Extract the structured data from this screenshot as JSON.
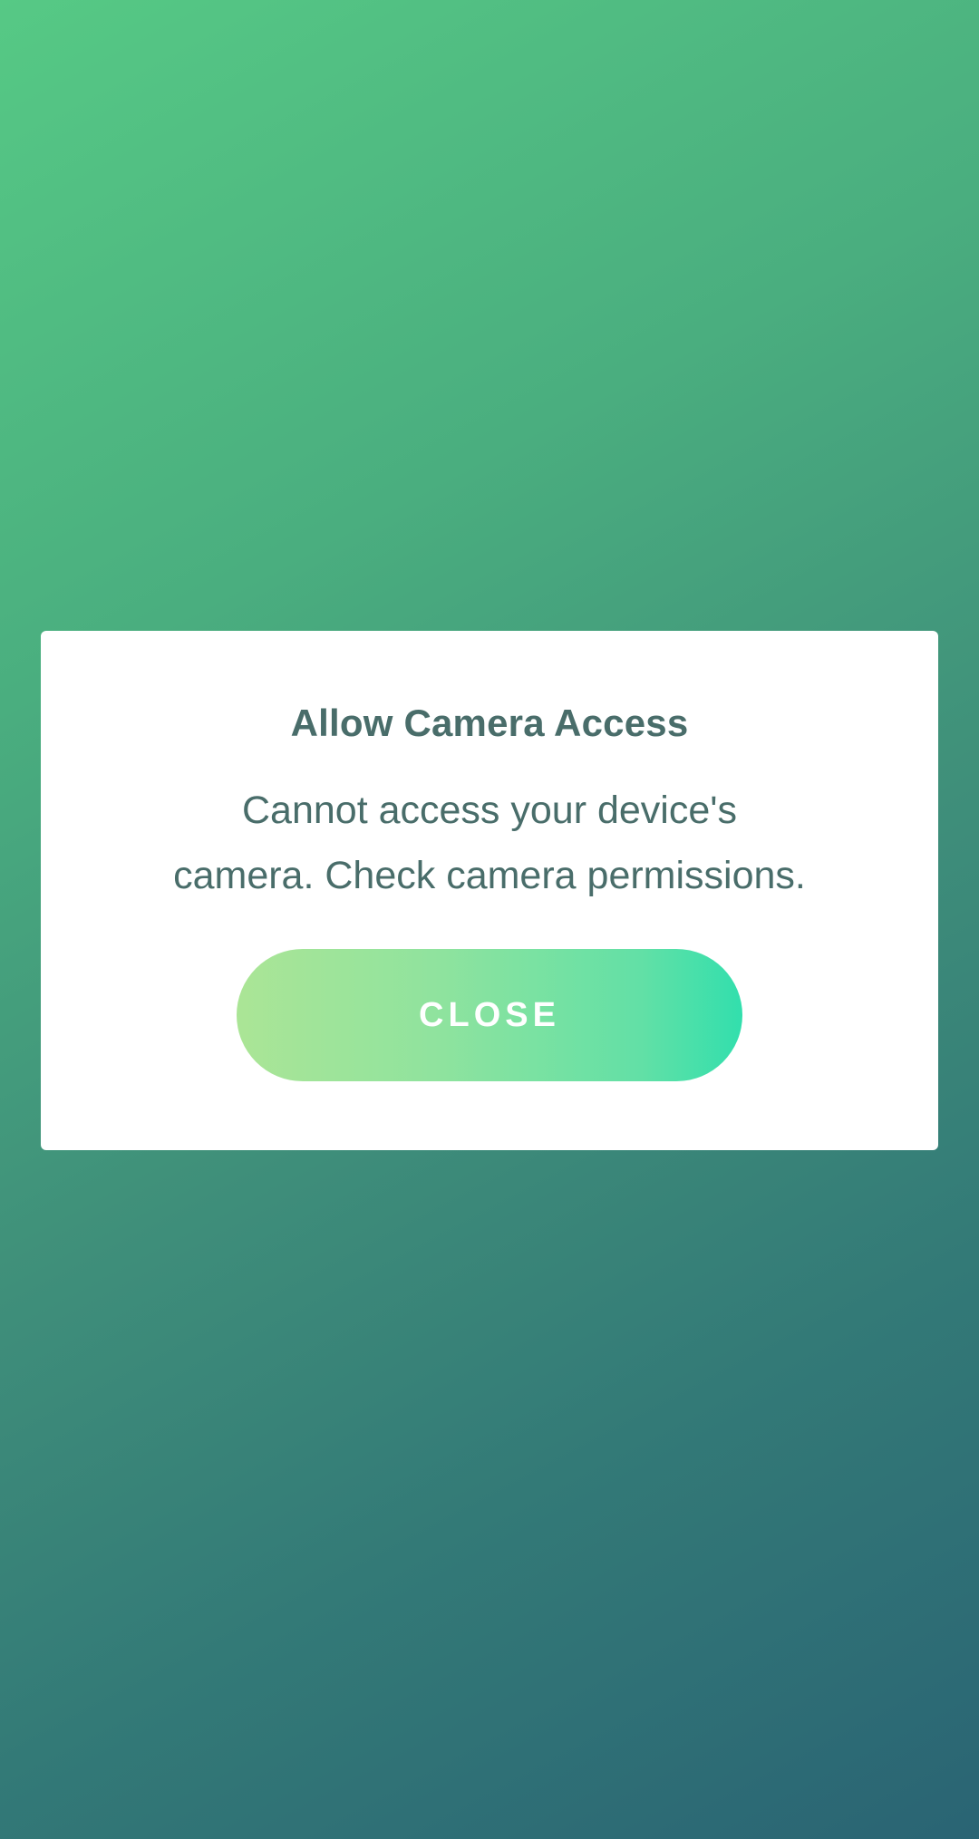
{
  "dialog": {
    "title": "Allow Camera Access",
    "message_line1": "Cannot access your device's",
    "message_line2": "camera. Check camera permissions.",
    "close_label": "CLOSE"
  },
  "colors": {
    "background_top_left": "#56c985",
    "background_bottom_right": "#2a6474",
    "dialog_background": "#ffffff",
    "text": "#496d6a",
    "button_gradient_start": "#abe596",
    "button_gradient_end": "#32dfad",
    "button_text": "#ffffff"
  }
}
